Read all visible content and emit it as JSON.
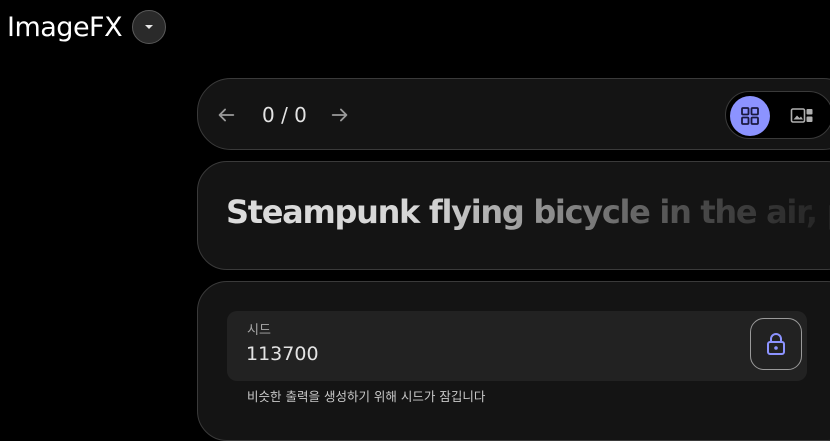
{
  "app": {
    "title": "ImageFX",
    "dropdown_icon": "caret-down-icon"
  },
  "navigation": {
    "counter": "0 / 0",
    "prev_icon": "arrow-left-icon",
    "next_icon": "arrow-right-icon"
  },
  "view_toggle": {
    "active": "grid",
    "options": [
      "grid-view-icon",
      "single-view-icon"
    ],
    "accent_color": "#8c93ff"
  },
  "prompt": {
    "text": "Steampunk flying bicycle in the air, powered"
  },
  "seed": {
    "label": "시드",
    "value": "113700",
    "lock_icon": "lock-icon",
    "helper": "비슷한 출력을 생성하기 위해 시드가 잠깁니다"
  }
}
